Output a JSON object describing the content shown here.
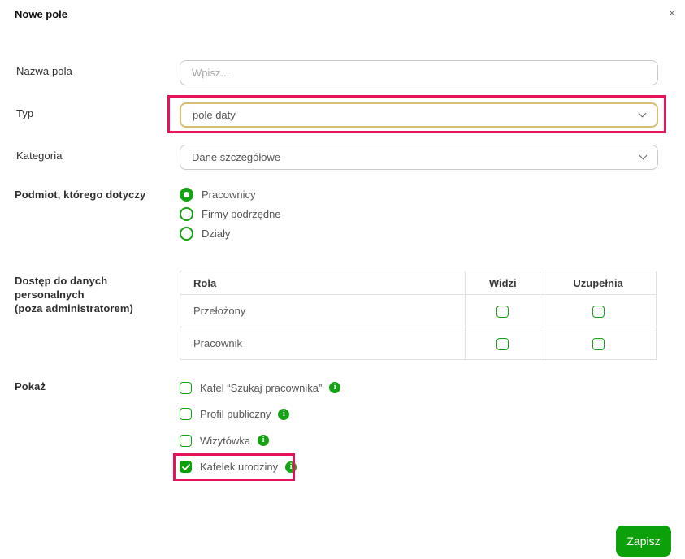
{
  "dialog": {
    "title": "Nowe pole"
  },
  "icons": {
    "close": "×",
    "info": "i"
  },
  "colors": {
    "brand_green": "#0ca00a",
    "outline_green": "#14a312",
    "highlight_red": "#e4135a",
    "focus_gold": "#d9bd73"
  },
  "fields": {
    "name": {
      "label": "Nazwa pola",
      "value": "",
      "placeholder": "Wpisz..."
    },
    "type": {
      "label": "Typ",
      "value": "pole daty"
    },
    "category": {
      "label": "Kategoria",
      "value": "Dane szczegółowe"
    }
  },
  "subject": {
    "label": "Podmiot, którego dotyczy",
    "options": [
      {
        "label": "Pracownicy",
        "selected": true
      },
      {
        "label": "Firmy podrzędne",
        "selected": false
      },
      {
        "label": "Działy",
        "selected": false
      }
    ]
  },
  "access": {
    "label_line1": "Dostęp do danych personalnych",
    "label_line2": "(poza administratorem)",
    "table": {
      "headers": [
        "Rola",
        "Widzi",
        "Uzupełnia"
      ],
      "rows": [
        {
          "role": "Przełożony",
          "widzi": false,
          "uzupelnia": false
        },
        {
          "role": "Pracownik",
          "widzi": false,
          "uzupelnia": false
        }
      ]
    }
  },
  "show": {
    "label": "Pokaż",
    "options": [
      {
        "label": "Kafel “Szukaj pracownika”",
        "checked": false
      },
      {
        "label": "Profil publiczny",
        "checked": false
      },
      {
        "label": "Wizytówka",
        "checked": false
      },
      {
        "label": "Kafelek urodziny",
        "checked": true
      }
    ]
  },
  "footer": {
    "save_label": "Zapisz"
  }
}
